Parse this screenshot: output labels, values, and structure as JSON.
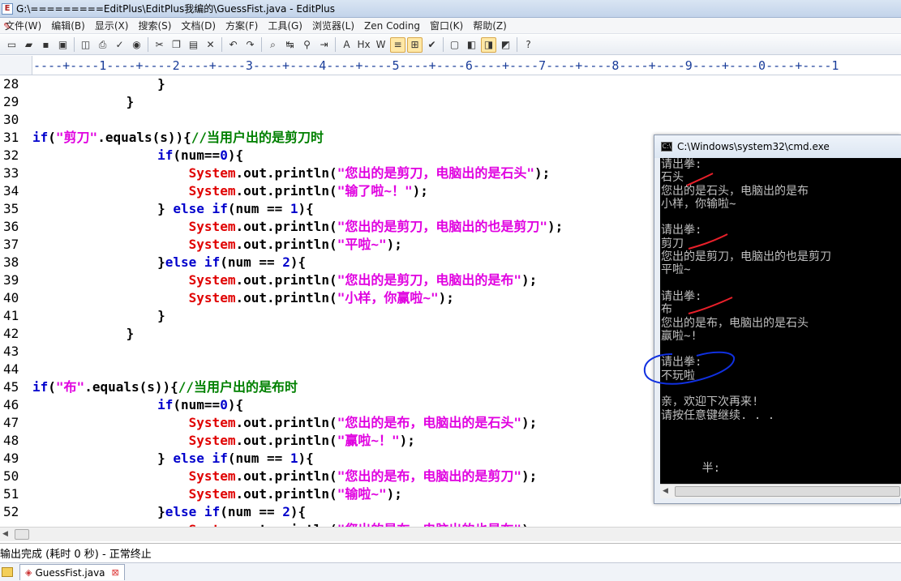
{
  "window": {
    "title": "G:\\=========EditPlus\\EditPlus我编的\\GuessFist.java - EditPlus"
  },
  "menu": [
    "文件(W)",
    "编辑(B)",
    "显示(X)",
    "搜索(S)",
    "文档(D)",
    "方案(F)",
    "工具(G)",
    "浏览器(L)",
    "Zen Coding",
    "窗口(K)",
    "帮助(Z)"
  ],
  "toolbar": [
    {
      "icon": "new-file-icon",
      "glyph": "▭"
    },
    {
      "icon": "open-folder-icon",
      "glyph": "▰"
    },
    {
      "icon": "save-icon",
      "glyph": "▪"
    },
    {
      "icon": "save-all-icon",
      "glyph": "▣"
    },
    {
      "sep": true
    },
    {
      "icon": "print-preview-icon",
      "glyph": "◫"
    },
    {
      "icon": "print-icon",
      "glyph": "⎙"
    },
    {
      "icon": "spell-check-icon",
      "glyph": "✓"
    },
    {
      "icon": "browser-icon",
      "glyph": "◉"
    },
    {
      "sep": true
    },
    {
      "icon": "cut-icon",
      "glyph": "✂"
    },
    {
      "icon": "copy-icon",
      "glyph": "❐"
    },
    {
      "icon": "paste-icon",
      "glyph": "▤"
    },
    {
      "icon": "delete-icon",
      "glyph": "✕"
    },
    {
      "sep": true
    },
    {
      "icon": "undo-icon",
      "glyph": "↶"
    },
    {
      "icon": "redo-icon",
      "glyph": "↷"
    },
    {
      "sep": true
    },
    {
      "icon": "find-icon",
      "glyph": "⌕"
    },
    {
      "icon": "replace-icon",
      "glyph": "↹"
    },
    {
      "icon": "find-in-files-icon",
      "glyph": "⚲"
    },
    {
      "icon": "goto-line-icon",
      "glyph": "⇥"
    },
    {
      "sep": true
    },
    {
      "icon": "font-icon",
      "glyph": "A"
    },
    {
      "icon": "hex-view-icon",
      "glyph": "Hx"
    },
    {
      "icon": "word-wrap-icon",
      "glyph": "W"
    },
    {
      "icon": "line-number-icon",
      "glyph": "≡",
      "active": true
    },
    {
      "icon": "ruler-icon",
      "glyph": "⊞",
      "active": true
    },
    {
      "icon": "check-icon",
      "glyph": "✔"
    },
    {
      "sep": true
    },
    {
      "icon": "full-screen-icon",
      "glyph": "▢"
    },
    {
      "icon": "directory-window-icon",
      "glyph": "◧"
    },
    {
      "icon": "output-window-icon",
      "glyph": "◨",
      "active": true
    },
    {
      "icon": "cliptext-icon",
      "glyph": "◩"
    },
    {
      "sep": true
    },
    {
      "icon": "help-icon",
      "glyph": "?"
    }
  ],
  "ruler": {
    "marks": "----+----1----+----2----+----3----+----4----+----5----+----6----+----7----+----8----+----9----+----0----+----1"
  },
  "code": [
    {
      "n": "28",
      "tokens": [
        [
          "sp",
          "                "
        ],
        [
          "op",
          "}"
        ]
      ]
    },
    {
      "n": "29",
      "tokens": [
        [
          "sp",
          "            "
        ],
        [
          "op",
          "}"
        ]
      ]
    },
    {
      "n": "30",
      "tokens": []
    },
    {
      "n": "31",
      "tokens": [
        [
          "kw",
          "if"
        ],
        [
          "op",
          "("
        ],
        [
          "str",
          "\"剪刀\""
        ],
        [
          "op",
          ".equals(s)){"
        ],
        [
          "com",
          "//当用户出的是剪刀时"
        ]
      ]
    },
    {
      "n": "32",
      "tokens": [
        [
          "sp",
          "                "
        ],
        [
          "kw",
          "if"
        ],
        [
          "op",
          "(num=="
        ],
        [
          "num",
          "0"
        ],
        [
          "op",
          "){"
        ]
      ]
    },
    {
      "n": "33",
      "tokens": [
        [
          "sp",
          "                    "
        ],
        [
          "sys",
          "System"
        ],
        [
          "op",
          ".out.println("
        ],
        [
          "str",
          "\"您出的是剪刀，电脑出的是石头\""
        ],
        [
          "op",
          ");"
        ]
      ]
    },
    {
      "n": "34",
      "tokens": [
        [
          "sp",
          "                    "
        ],
        [
          "sys",
          "System"
        ],
        [
          "op",
          ".out.println("
        ],
        [
          "str",
          "\"输了啦~！\""
        ],
        [
          "op",
          ");"
        ]
      ]
    },
    {
      "n": "35",
      "tokens": [
        [
          "sp",
          "                "
        ],
        [
          "op",
          "} "
        ],
        [
          "kw",
          "else if"
        ],
        [
          "op",
          "(num == "
        ],
        [
          "num",
          "1"
        ],
        [
          "op",
          "){"
        ]
      ]
    },
    {
      "n": "36",
      "tokens": [
        [
          "sp",
          "                    "
        ],
        [
          "sys",
          "System"
        ],
        [
          "op",
          ".out.println("
        ],
        [
          "str",
          "\"您出的是剪刀，电脑出的也是剪刀\""
        ],
        [
          "op",
          ");"
        ]
      ]
    },
    {
      "n": "37",
      "tokens": [
        [
          "sp",
          "                    "
        ],
        [
          "sys",
          "System"
        ],
        [
          "op",
          ".out.println("
        ],
        [
          "str",
          "\"平啦~\""
        ],
        [
          "op",
          ");"
        ]
      ]
    },
    {
      "n": "38",
      "tokens": [
        [
          "sp",
          "                "
        ],
        [
          "op",
          "}"
        ],
        [
          "kw",
          "else if"
        ],
        [
          "op",
          "(num == "
        ],
        [
          "num",
          "2"
        ],
        [
          "op",
          "){"
        ]
      ]
    },
    {
      "n": "39",
      "tokens": [
        [
          "sp",
          "                    "
        ],
        [
          "sys",
          "System"
        ],
        [
          "op",
          ".out.println("
        ],
        [
          "str",
          "\"您出的是剪刀，电脑出的是布\""
        ],
        [
          "op",
          ");"
        ]
      ]
    },
    {
      "n": "40",
      "tokens": [
        [
          "sp",
          "                    "
        ],
        [
          "sys",
          "System"
        ],
        [
          "op",
          ".out.println("
        ],
        [
          "str",
          "\"小样，你赢啦~\""
        ],
        [
          "op",
          ");"
        ]
      ]
    },
    {
      "n": "41",
      "tokens": [
        [
          "sp",
          "                "
        ],
        [
          "op",
          "}"
        ]
      ]
    },
    {
      "n": "42",
      "tokens": [
        [
          "sp",
          "            "
        ],
        [
          "op",
          "}"
        ]
      ]
    },
    {
      "n": "43",
      "tokens": []
    },
    {
      "n": "44",
      "tokens": []
    },
    {
      "n": "45",
      "tokens": [
        [
          "kw",
          "if"
        ],
        [
          "op",
          "("
        ],
        [
          "str",
          "\"布\""
        ],
        [
          "op",
          ".equals(s)){"
        ],
        [
          "com",
          "//当用户出的是布时"
        ]
      ]
    },
    {
      "n": "46",
      "tokens": [
        [
          "sp",
          "                "
        ],
        [
          "kw",
          "if"
        ],
        [
          "op",
          "(num=="
        ],
        [
          "num",
          "0"
        ],
        [
          "op",
          "){"
        ]
      ]
    },
    {
      "n": "47",
      "tokens": [
        [
          "sp",
          "                    "
        ],
        [
          "sys",
          "System"
        ],
        [
          "op",
          ".out.println("
        ],
        [
          "str",
          "\"您出的是布，电脑出的是石头\""
        ],
        [
          "op",
          ");"
        ]
      ]
    },
    {
      "n": "48",
      "tokens": [
        [
          "sp",
          "                    "
        ],
        [
          "sys",
          "System"
        ],
        [
          "op",
          ".out.println("
        ],
        [
          "str",
          "\"赢啦~！\""
        ],
        [
          "op",
          ");"
        ]
      ]
    },
    {
      "n": "49",
      "tokens": [
        [
          "sp",
          "                "
        ],
        [
          "op",
          "} "
        ],
        [
          "kw",
          "else if"
        ],
        [
          "op",
          "(num == "
        ],
        [
          "num",
          "1"
        ],
        [
          "op",
          "){"
        ]
      ]
    },
    {
      "n": "50",
      "tokens": [
        [
          "sp",
          "                    "
        ],
        [
          "sys",
          "System"
        ],
        [
          "op",
          ".out.println("
        ],
        [
          "str",
          "\"您出的是布，电脑出的是剪刀\""
        ],
        [
          "op",
          ");"
        ]
      ]
    },
    {
      "n": "51",
      "tokens": [
        [
          "sp",
          "                    "
        ],
        [
          "sys",
          "System"
        ],
        [
          "op",
          ".out.println("
        ],
        [
          "str",
          "\"输啦~\""
        ],
        [
          "op",
          ");"
        ]
      ]
    },
    {
      "n": "52",
      "tokens": [
        [
          "sp",
          "                "
        ],
        [
          "op",
          "}"
        ],
        [
          "kw",
          "else if"
        ],
        [
          "op",
          "(num == "
        ],
        [
          "num",
          "2"
        ],
        [
          "op",
          "){"
        ]
      ]
    },
    {
      "n": "",
      "tokens": [
        [
          "sp",
          "                    "
        ],
        [
          "sys",
          "System"
        ],
        [
          "op",
          ".out.println("
        ],
        [
          "str",
          "\"您出的是布，电脑出的也是布\""
        ],
        [
          "op",
          ");"
        ]
      ]
    }
  ],
  "output": {
    "status": "输出完成 (耗时 0 秒) - 正常终止"
  },
  "tabs": [
    {
      "label": "GuessFist.java"
    }
  ],
  "cmd": {
    "title": "C:\\Windows\\system32\\cmd.exe",
    "lines": [
      "请出拳:",
      "石头",
      "您出的是石头，电脑出的是布",
      "小样，你输啦~",
      "",
      "请出拳:",
      "剪刀",
      "您出的是剪刀，电脑出的也是剪刀",
      "平啦~",
      "",
      "请出拳:",
      "布",
      "您出的是布，电脑出的是石头",
      "赢啦~!",
      "",
      "请出拳:",
      "不玩啦",
      "",
      "亲，欢迎下次再来!",
      "请按任意键继续. . .",
      "",
      "",
      "",
      "      半:"
    ]
  },
  "colors": {
    "keyword": "#0000cc",
    "string": "#e000e0",
    "system": "#e00000",
    "comment": "#008000",
    "annotation_red": "#e8202a",
    "annotation_blue": "#1030e0"
  }
}
